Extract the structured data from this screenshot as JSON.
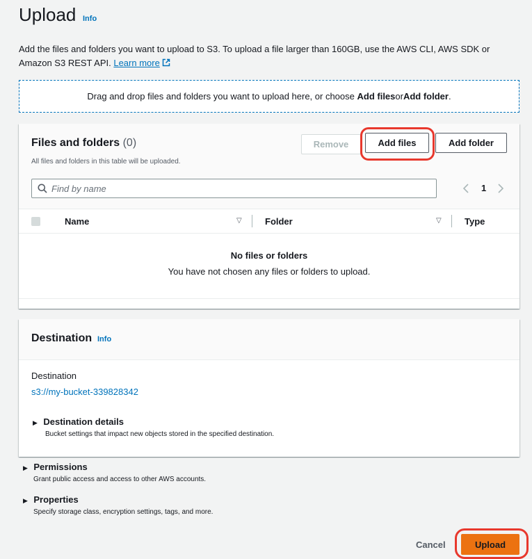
{
  "header": {
    "title": "Upload",
    "info": "Info",
    "intro_text": "Add the files and folders you want to upload to S3. To upload a file larger than 160GB, use the AWS CLI, AWS SDK or Amazon S3 REST API.",
    "learn_more": "Learn more"
  },
  "dropzone": {
    "text_before": "Drag and drop files and folders you want to upload here, or choose ",
    "add_files": "Add files",
    "or": " or ",
    "add_folder": "Add folder",
    "end": "."
  },
  "files_panel": {
    "heading": "Files and folders",
    "count": "(0)",
    "subtitle": "All files and folders in this table will be uploaded.",
    "buttons": {
      "remove": "Remove",
      "add_files": "Add files",
      "add_folder": "Add folder"
    },
    "search": {
      "placeholder": "Find by name"
    },
    "pagination": {
      "page": "1"
    },
    "columns": [
      "Name",
      "Folder",
      "Type"
    ],
    "empty_title": "No files or folders",
    "empty_desc": "You have not chosen any files or folders to upload."
  },
  "destination_panel": {
    "heading": "Destination",
    "info": "Info",
    "label": "Destination",
    "value": "s3://my-bucket-339828342",
    "details_title": "Destination details",
    "details_desc": "Bucket settings that impact new objects stored in the specified destination."
  },
  "permissions": {
    "title": "Permissions",
    "desc": "Grant public access and access to other AWS accounts."
  },
  "properties": {
    "title": "Properties",
    "desc": "Specify storage class, encryption settings, tags, and more."
  },
  "footer": {
    "cancel": "Cancel",
    "upload": "Upload"
  },
  "colors": {
    "accent": "#0073bb",
    "primary_button": "#ec7211",
    "highlight": "#e8382d"
  },
  "icons": [
    "external-link-icon",
    "search-icon",
    "chevron-left-icon",
    "chevron-right-icon",
    "sort-icon",
    "caret-right-icon"
  ]
}
